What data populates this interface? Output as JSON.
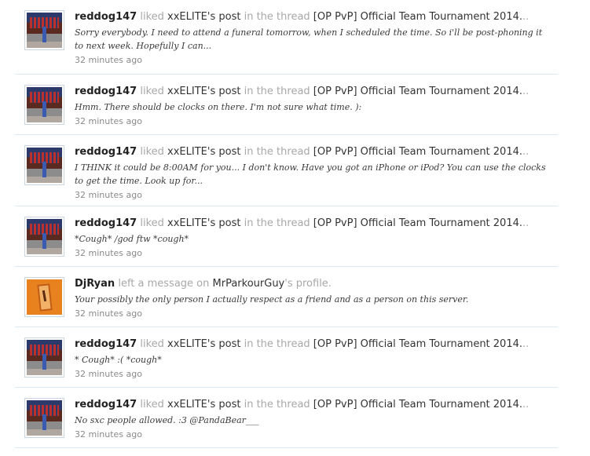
{
  "feed": {
    "items": [
      {
        "user": "reddog147",
        "verb": "liked",
        "object_user": "xxELITE",
        "object_suffix": "'s post",
        "connector": "in the thread",
        "target": "[OP PvP] Official Team Tournament 2014.",
        "trail": "..",
        "snippet": "Sorry everybody. I need to attend a funeral tomorrow, when I scheduled the time. So i'll be post-phoning it to next week. Hopefully I can...",
        "time": "32 minutes ago",
        "avatar": "reddog147-avatar"
      },
      {
        "user": "reddog147",
        "verb": "liked",
        "object_user": "xxELITE",
        "object_suffix": "'s post",
        "connector": "in the thread",
        "target": "[OP PvP] Official Team Tournament 2014.",
        "trail": "..",
        "snippet": "Hmm. There should be clocks on there. I'm not sure what time. ):",
        "time": "32 minutes ago",
        "avatar": "reddog147-avatar"
      },
      {
        "user": "reddog147",
        "verb": "liked",
        "object_user": "xxELITE",
        "object_suffix": "'s post",
        "connector": "in the thread",
        "target": "[OP PvP] Official Team Tournament 2014.",
        "trail": "..",
        "snippet": "I THINK it could be 8:00AM for you... I don't know. Have you got an iPhone or iPod? You can use the clocks to get the time. Look up for...",
        "time": "32 minutes ago",
        "avatar": "reddog147-avatar"
      },
      {
        "user": "reddog147",
        "verb": "liked",
        "object_user": "xxELITE",
        "object_suffix": "'s post",
        "connector": "in the thread",
        "target": "[OP PvP] Official Team Tournament 2014.",
        "trail": "..",
        "snippet": "*Cough* /god ftw *cough*",
        "time": "32 minutes ago",
        "avatar": "reddog147-avatar"
      },
      {
        "user": "DjRyan",
        "verb": "left a message on",
        "object_user": "MrParkourGuy",
        "object_suffix": "'s profile.",
        "connector": "",
        "target": "",
        "trail": "",
        "snippet": "Your possibly the only person I actually respect as a friend and as a person on this server.",
        "time": "32 minutes ago",
        "avatar": "djryan-avatar"
      },
      {
        "user": "reddog147",
        "verb": "liked",
        "object_user": "xxELITE",
        "object_suffix": "'s post",
        "connector": "in the thread",
        "target": "[OP PvP] Official Team Tournament 2014.",
        "trail": "..",
        "snippet": "* Cough* :( *cough*",
        "time": "32 minutes ago",
        "avatar": "reddog147-avatar"
      },
      {
        "user": "reddog147",
        "verb": "liked",
        "object_user": "xxELITE",
        "object_suffix": "'s post",
        "connector": "in the thread",
        "target": "[OP PvP] Official Team Tournament 2014.",
        "trail": "..",
        "snippet": "No sxc people allowed. :3 @PandaBear___",
        "time": "32 minutes ago",
        "avatar": "reddog147-avatar"
      }
    ]
  }
}
